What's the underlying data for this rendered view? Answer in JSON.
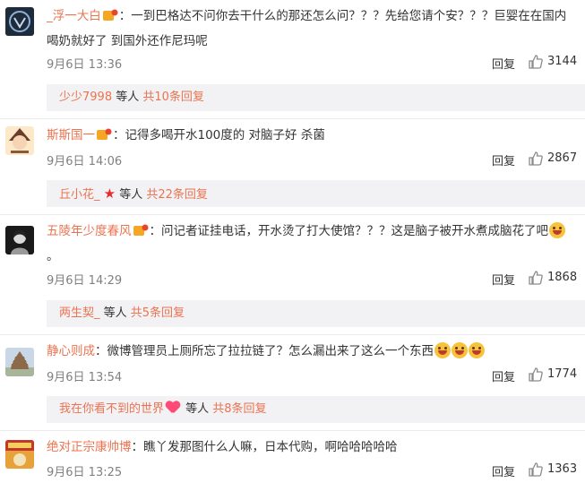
{
  "comments": [
    {
      "username": "_浮一大白",
      "text": "：一到巴格达不问你去干什么的那还怎么问？？？先给您请个安？？？巨婴在在国内喝奶就好了 到国外还作尼玛呢",
      "date": "9月6日 13:36",
      "reply_label": "回复",
      "likes": "3144",
      "replies": {
        "user": "少少7998",
        "mid": " 等人 ",
        "count": "共10条回复"
      }
    },
    {
      "username": "斯斯国一",
      "text": "：记得多喝开水100度的 对脑子好 杀菌",
      "date": "9月6日 14:06",
      "reply_label": "回复",
      "likes": "2867",
      "replies": {
        "user": "丘小花_",
        "mid": " 等人 ",
        "count": "共22条回复"
      }
    },
    {
      "username": "五陵年少度春风",
      "text": "：问记者证挂电话，开水烫了打大使馆？？？这是脑子被开水煮成脑花了吧",
      "text_end": "。",
      "date": "9月6日 14:29",
      "reply_label": "回复",
      "likes": "1868",
      "replies": {
        "user": "两生契_",
        "mid": " 等人 ",
        "count": "共5条回复"
      }
    },
    {
      "username": "静心则成",
      "text": "：微博管理员上厕所忘了拉拉链了？怎么漏出来了这么一个东西",
      "date": "9月6日 13:54",
      "reply_label": "回复",
      "likes": "1774",
      "replies": {
        "user": "我在你看不到的世界",
        "mid": " 等人 ",
        "count": "共8条回复"
      }
    },
    {
      "username": "绝对正宗康帅博",
      "text": "：瞧丫发那图什么人嘛，日本代购，啊哈哈哈哈哈",
      "date": "9月6日 13:25",
      "reply_label": "回复",
      "likes": "1363"
    }
  ],
  "colors": {
    "username": "#eb7350",
    "reply_bg": "#f2f2f5",
    "meta": "#808080"
  }
}
